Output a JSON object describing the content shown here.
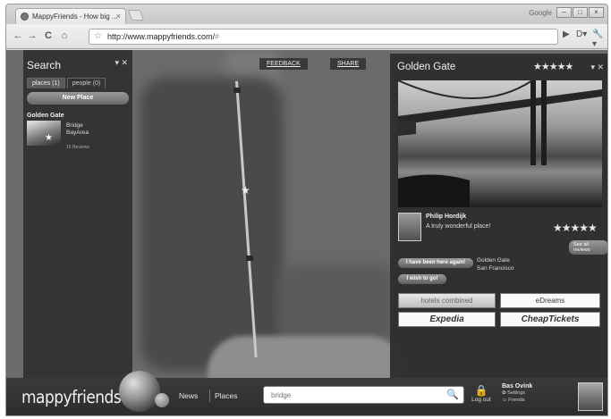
{
  "browser": {
    "tab_title": "MappyFriends - How big ...",
    "tab_close": "×",
    "profile_label": "Google",
    "url_host": "http://www.mappyfriends.com/",
    "url_rest": "#",
    "back": "←",
    "forward": "→",
    "reload": "C",
    "home": "⌂",
    "page_menu": "▶",
    "doc_menu": "D▾",
    "tools_menu": "🔧▾"
  },
  "map": {
    "feedback_label": "FEEDBACK",
    "share_label": "SHARE"
  },
  "search_panel": {
    "title": "Search",
    "controls": "▾ ✕",
    "tabs": [
      {
        "label": "places (1)",
        "active": true
      },
      {
        "label": "people (0)",
        "active": false
      }
    ],
    "new_place_label": "New Place",
    "results": [
      {
        "title": "Golden Gate",
        "line1": "Bridge",
        "line2": "BayArea",
        "reviews": "15 Reviews"
      }
    ]
  },
  "place_panel": {
    "title": "Golden Gate",
    "stars": "★★★★★",
    "controls": "▾ ✕",
    "review": {
      "author": "Philip Hordijk",
      "text": "A truly wonderful place!",
      "stars": "★★★★★"
    },
    "see_all_label": "See all reviews",
    "been_here_label": "I have been here again!",
    "wish_label": "I wish to go!",
    "location_name": "Golden Gate",
    "location_city": "San Francisco",
    "ads": {
      "hotels": "hotels combined",
      "edreams": "eDreams",
      "expedia": "Expedia",
      "cheaptickets": "CheapTickets"
    }
  },
  "bottom_bar": {
    "logo": "mappyfriends",
    "news_label": "News",
    "places_label": "Places",
    "search_value": "bridge",
    "logout_label": "Log out",
    "user_name": "Bas Ovink",
    "user_settings": "Settings",
    "user_friends": "Friends"
  },
  "colors": {
    "panel_bg": "#2d2d2d",
    "map_bg": "#6b6b6b",
    "accent_button": "#7a7a7a"
  }
}
